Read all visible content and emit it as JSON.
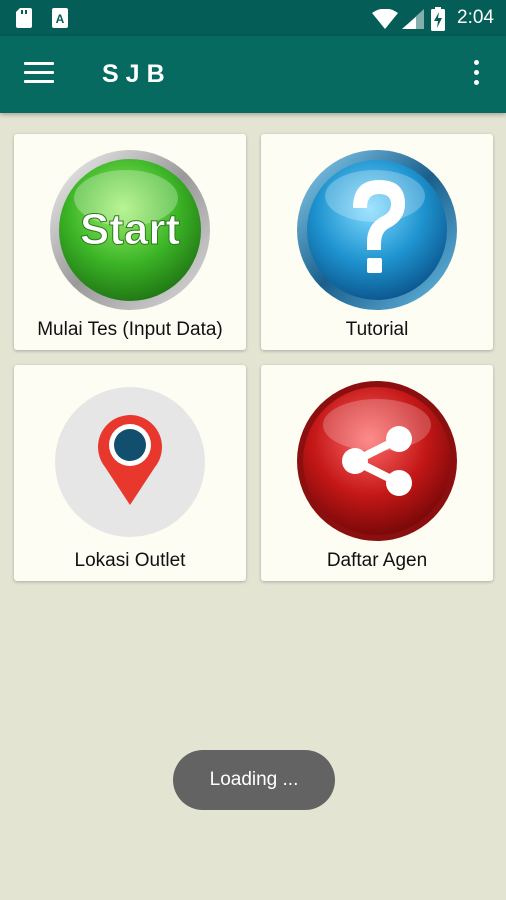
{
  "status_bar": {
    "time": "2:04"
  },
  "app_bar": {
    "title": "SJB"
  },
  "menu": [
    {
      "label": "Mulai Tes (Input Data)",
      "icon": "start-button-icon",
      "badge_text": "Start",
      "color": "#3cb527"
    },
    {
      "label": "Tutorial",
      "icon": "help-question-icon",
      "color": "#1e93cf"
    },
    {
      "label": "Lokasi Outlet",
      "icon": "location-pin-icon",
      "color": "#e8382e"
    },
    {
      "label": "Daftar Agen",
      "icon": "share-icon",
      "color": "#c41717"
    }
  ],
  "toast": {
    "text": "Loading ..."
  },
  "colors": {
    "primary": "#066a61",
    "primary_dark": "#045d56",
    "background": "#e4e4d3",
    "card": "#fdfdf4"
  }
}
